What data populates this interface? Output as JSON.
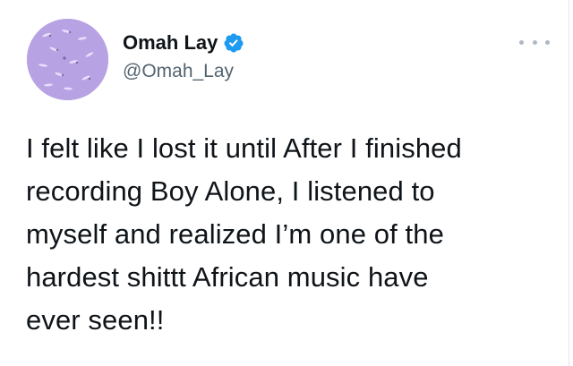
{
  "author": {
    "display_name": "Omah Lay",
    "handle": "@Omah_Lay",
    "verified": true,
    "verified_color": "#1d9bf0",
    "avatar_bg": "#b7a2e3"
  },
  "icons": {
    "verified": "verified-badge-icon",
    "more": "more-options-icon"
  },
  "tweet": {
    "lines": [
      "I felt like I lost it until After I finished",
      "recording Boy Alone, I listened to",
      "myself and realized I’m one of the",
      "hardest shittt African music have",
      "ever seen!!"
    ]
  }
}
